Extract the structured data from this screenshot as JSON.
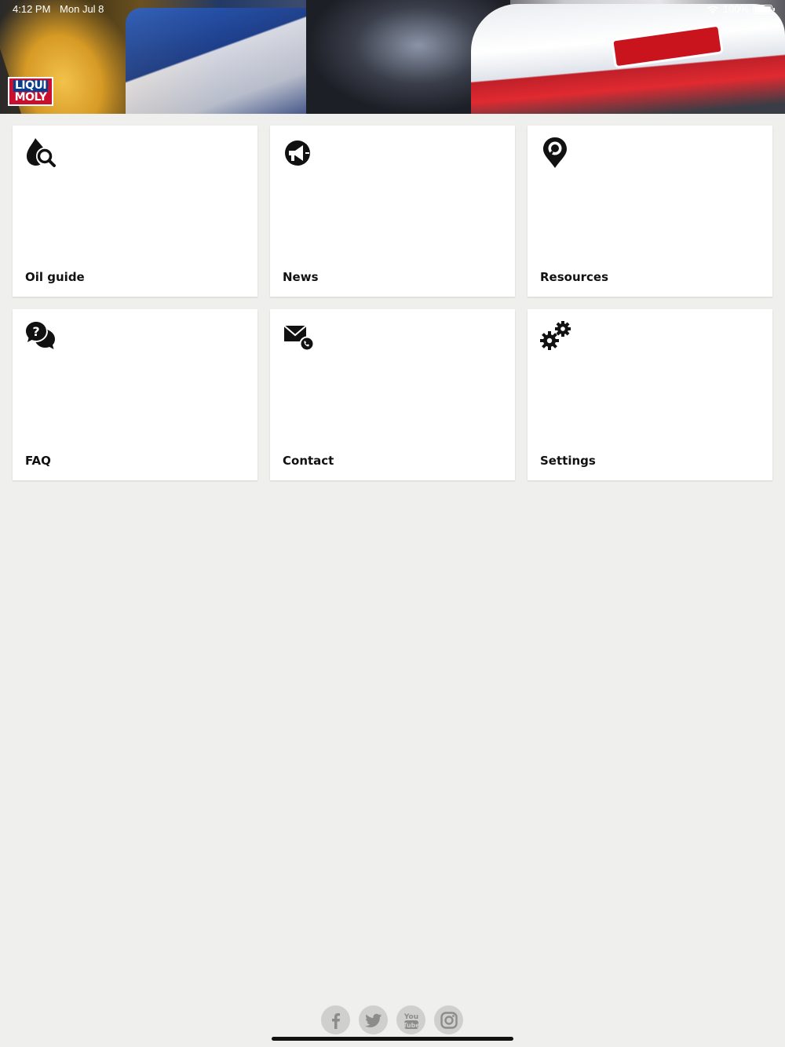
{
  "status_bar": {
    "time": "4:12 PM",
    "date": "Mon Jul 8",
    "battery": "100%"
  },
  "header": {
    "logo_top": "LIQUI",
    "logo_bottom": "MOLY"
  },
  "tiles": [
    {
      "label": "Oil guide",
      "icon": "oil-drop-search-icon"
    },
    {
      "label": "News",
      "icon": "megaphone-icon"
    },
    {
      "label": "Resources",
      "icon": "map-pin-icon"
    },
    {
      "label": "FAQ",
      "icon": "chat-question-icon"
    },
    {
      "label": "Contact",
      "icon": "mail-phone-icon"
    },
    {
      "label": "Settings",
      "icon": "gears-icon"
    }
  ],
  "social": [
    "facebook-icon",
    "twitter-icon",
    "youtube-icon",
    "instagram-icon"
  ],
  "colors": {
    "background": "#efefed",
    "tile": "#ffffff",
    "brand_red": "#c8102e",
    "brand_blue": "#0a3d8f",
    "social_button": "#cfcfcd"
  }
}
